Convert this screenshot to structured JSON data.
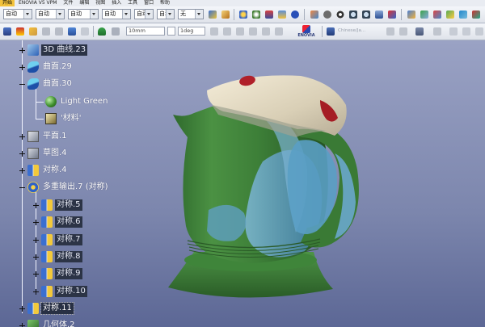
{
  "menu": {
    "items": [
      "开始",
      "ENOVIA V5 VPM",
      "文件",
      "编辑",
      "视图",
      "插入",
      "工具",
      "窗口",
      "帮助"
    ]
  },
  "toolbar1": {
    "combos": [
      "自动",
      "自动",
      "自动",
      "自动",
      "自动",
      "自动",
      "无"
    ]
  },
  "toolbar2": {
    "length_value": "10mm",
    "angle_value": "1deg",
    "faint_label": "Chinese/Ja..."
  },
  "tree": {
    "nodes": [
      {
        "label": "3D 曲线.23",
        "icon": "curve-icon"
      },
      {
        "label": "曲面.29",
        "icon": "surface-icon"
      },
      {
        "label": "曲面.30",
        "icon": "surface-icon"
      },
      {
        "label": "Light Green",
        "icon": "material-sphere-icon"
      },
      {
        "label": "'材料'",
        "icon": "material-library-icon"
      },
      {
        "label": "平面.1",
        "icon": "plane-icon"
      },
      {
        "label": "草图.4",
        "icon": "sketch-icon"
      },
      {
        "label": "对称.4",
        "icon": "symmetry-icon"
      },
      {
        "label": "多重输出.7 (对称)",
        "icon": "multi-output-icon"
      },
      {
        "label": "对称.5",
        "icon": "symmetry-icon"
      },
      {
        "label": "对称.6",
        "icon": "symmetry-icon"
      },
      {
        "label": "对称.7",
        "icon": "symmetry-icon"
      },
      {
        "label": "对称.8",
        "icon": "symmetry-icon"
      },
      {
        "label": "对称.9",
        "icon": "symmetry-icon"
      },
      {
        "label": "对称.10",
        "icon": "symmetry-icon"
      },
      {
        "label": "对称.11",
        "icon": "symmetry-icon"
      },
      {
        "label": "几何体.2",
        "icon": "body-icon"
      }
    ]
  },
  "colors": {
    "kettle_body": "#3f7f3a",
    "kettle_lid": "#e6dcc4",
    "kettle_glass": "#5c9bc0",
    "kettle_button": "#b0202a",
    "background_top": "#9aa2c4",
    "background_bottom": "#5c6795"
  }
}
